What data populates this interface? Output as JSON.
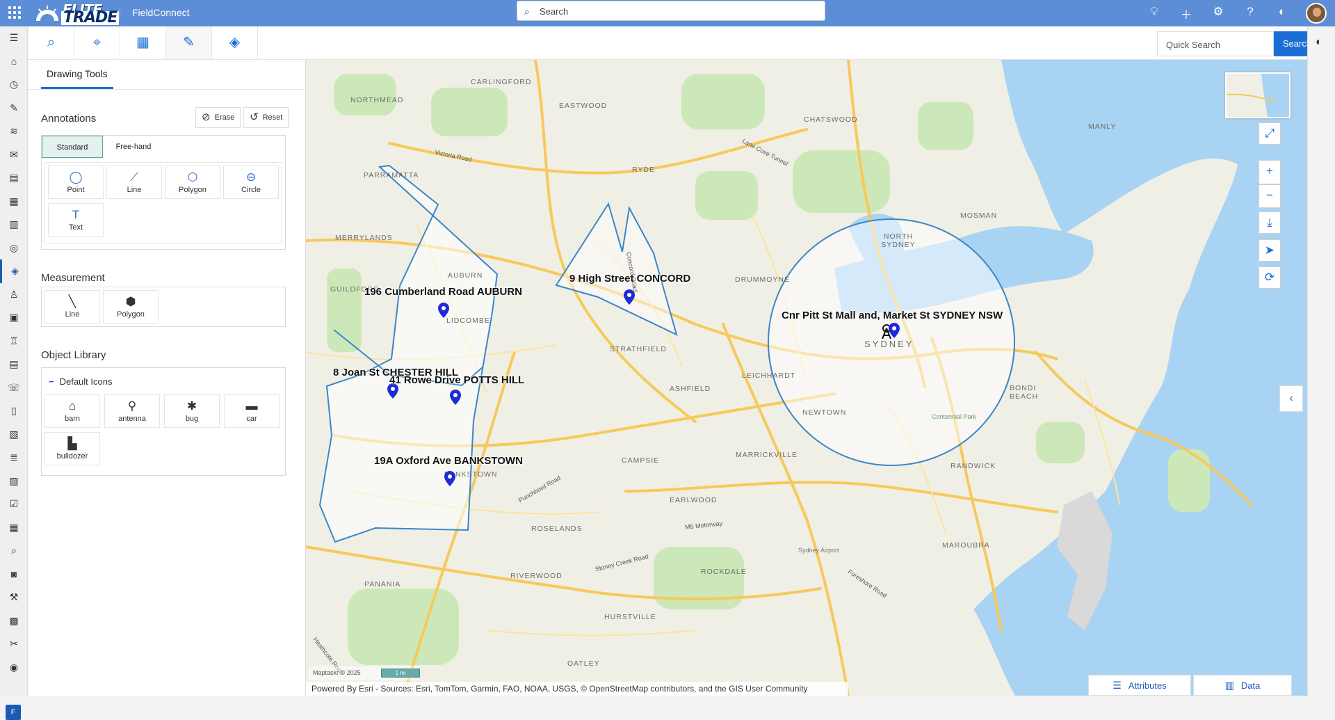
{
  "app": {
    "logo_line1": "ELITE",
    "logo_line2": "TRADE",
    "name": "FieldConnect"
  },
  "top_search": {
    "placeholder": "Search"
  },
  "top_icons": [
    "lightbulb-icon",
    "plus-icon",
    "gear-icon",
    "help-icon",
    "copilot-icon"
  ],
  "quick_search": {
    "placeholder": "Quick Search",
    "button": "Search"
  },
  "panel": {
    "tab": "Drawing Tools",
    "annotations": {
      "title": "Annotations",
      "erase": "Erase",
      "reset": "Reset",
      "modes": [
        "Standard",
        "Free-hand"
      ],
      "active_mode": "Standard",
      "tools": [
        "Point",
        "Line",
        "Polygon",
        "Circle",
        "Text"
      ]
    },
    "measurement": {
      "title": "Measurement",
      "tools": [
        "Line",
        "Polygon"
      ]
    },
    "library": {
      "title": "Object Library",
      "group": "Default Icons",
      "icons": [
        "barn",
        "antenna",
        "bug",
        "car",
        "bulldozer"
      ]
    }
  },
  "map": {
    "addresses": {
      "auburn": "196 Cumberland Road AUBURN",
      "concord": "9 High Street CONCORD",
      "sydney": "Cnr Pitt St Mall and, Market St SYDNEY NSW",
      "chester": "8 Joan St CHESTER HILL",
      "potts": "41 Rowe Drive POTTS HILL",
      "bankstown": "19A Oxford Ave BANKSTOWN"
    },
    "suburbs": {
      "carlingford": "Carlingford",
      "northmead": "Northmead",
      "eastwood": "Eastwood",
      "parramatta": "Parramatta",
      "ryde": "Ryde",
      "chatswood": "Chatswood",
      "merrylands": "Merrylands",
      "manly": "Manly",
      "mosman": "Mosman",
      "north_sydney": "North Sydney",
      "guildford": "Guildford",
      "auburn": "Auburn",
      "lidcombe": "Lidcombe",
      "drummoyne": "Drummoyne",
      "strathfield": "Strathfield",
      "leichhardt": "Leichhardt",
      "sydney": "Sydney",
      "bondi": "Bondi Beach",
      "ashfield": "Ashfield",
      "newtown": "Newtown",
      "marrickville": "Marrickville",
      "campsie": "Campsie",
      "randwick": "Randwick",
      "bankstown": "Bankstown",
      "earlwood": "Earlwood",
      "roselands": "Roselands",
      "maroubra": "Maroubra",
      "rockdale": "Rockdale",
      "panania": "Panania",
      "riverwood": "Riverwood",
      "hurstville": "Hurstville",
      "oatley": "Oatley"
    },
    "roads": {
      "victoria": "Victoria Road",
      "lane_cove": "Lane Cove Tunnel",
      "m5": "M5 Motorway",
      "stoney": "Stoney Creek Road",
      "foreshore": "Foreshore Road",
      "punchbowl": "Punchbowl Road",
      "concord_rd": "Concord Road",
      "heathcote": "Heathcote Road"
    },
    "places": {
      "airport": "Sydney Airport",
      "park": "Centennial Park"
    },
    "scale": "1 mi",
    "scale_credit": "Maptaskr © 2025",
    "attribution": "Powered By Esri - Sources: Esri, TomTom, Garmin, FAO, NOAA, USGS, © OpenStreetMap contributors, and the GIS User Community"
  },
  "bottom": {
    "attributes": "Attributes",
    "data": "Data"
  },
  "colors": {
    "header": "#5b8ed6",
    "accent": "#1a6fd6",
    "water": "#a9d3f2",
    "shape_stroke": "#3a86c8",
    "pin": "#1d2bd8"
  }
}
